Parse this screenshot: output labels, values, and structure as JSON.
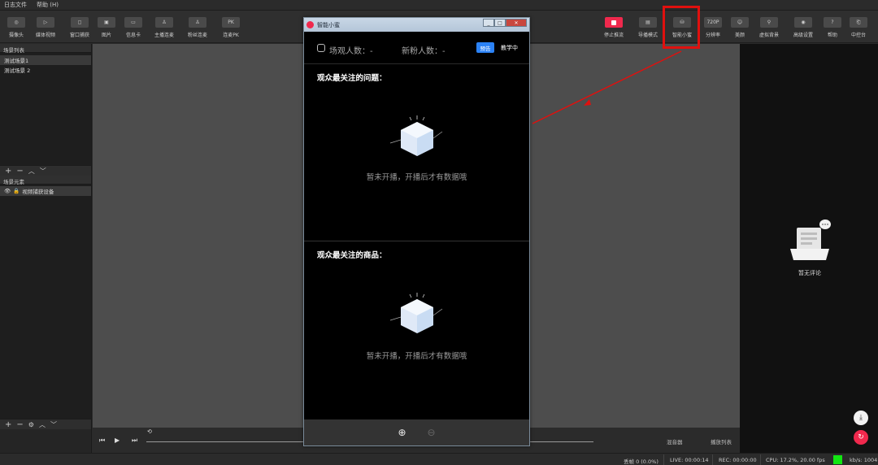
{
  "menu": [
    "日志文件",
    "帮助 (H)"
  ],
  "toolbar_left": [
    {
      "label": "摄像头",
      "icon": "camera-icon",
      "glyph": "◎"
    },
    {
      "label": "媒体视频",
      "icon": "play-icon",
      "glyph": "▷"
    },
    {
      "label": "窗口捕获",
      "icon": "window-icon",
      "glyph": "◻"
    },
    {
      "label": "图片",
      "icon": "image-icon",
      "glyph": "▣"
    },
    {
      "label": "信息卡",
      "icon": "card-icon",
      "glyph": "▭"
    },
    {
      "label": "主播连麦",
      "icon": "anchor-link-icon",
      "glyph": "♙"
    },
    {
      "label": "粉丝连麦",
      "icon": "fans-link-icon",
      "glyph": "♙"
    },
    {
      "label": "连麦PK",
      "icon": "pk-icon",
      "glyph": "PK"
    }
  ],
  "toolbar_right": [
    {
      "label": "停止推流",
      "icon": "stop-icon",
      "glyph": ""
    },
    {
      "label": "导播模式",
      "icon": "director-icon",
      "glyph": "▤"
    },
    {
      "label": "智能小蜜",
      "icon": "assistant-icon",
      "glyph": "⛁"
    },
    {
      "label": "分辨率",
      "icon": "resolution-icon",
      "glyph": "720P"
    },
    {
      "label": "美颜",
      "icon": "beauty-icon",
      "glyph": "☺"
    },
    {
      "label": "虚拟背景",
      "icon": "virtual-bg-icon",
      "glyph": "⚲"
    },
    {
      "label": "高级设置",
      "icon": "settings-icon",
      "glyph": "◉"
    },
    {
      "label": "帮助",
      "icon": "help-icon",
      "glyph": "?"
    },
    {
      "label": "中控台",
      "icon": "console-icon",
      "glyph": "⎗"
    }
  ],
  "scenes": {
    "header": "场景列表",
    "items": [
      "测试场景1",
      "测试场景 2"
    ]
  },
  "sources": {
    "header": "场景元素",
    "items": [
      "视频捕获设备"
    ]
  },
  "playbar": {
    "mixer": "混音器",
    "playlist": "播放列表"
  },
  "dialog": {
    "title": "智能小蜜",
    "viewers": "场观人数：-",
    "new_fans": "新粉人数：-",
    "preview_badge": "预告",
    "teaching": "教学中",
    "questions_title": "观众最关注的问题：",
    "products_title": "观众最关注的商品：",
    "empty_text": "暂未开播，开播后才有数据哦"
  },
  "comments": {
    "empty_text": "暂无评论"
  },
  "status": {
    "dropped": "丢帧 0 (0.0%)",
    "live": "LIVE: 00:00:14",
    "rec": "REC: 00:00:00",
    "cpu": "CPU: 17.2%, 20.00 fps",
    "kbps": "kb/s: 1004"
  },
  "colors": {
    "accent_red": "#f0294d",
    "highlight_red": "#e0100e",
    "badge_blue": "#2b82f6",
    "live_green": "#12e612"
  }
}
